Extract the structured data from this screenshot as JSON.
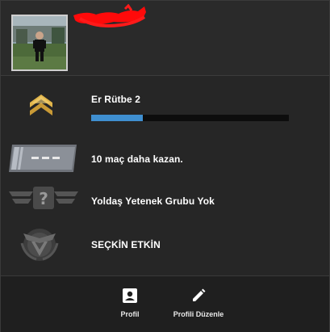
{
  "profile": {
    "avatar_icon": "player-avatar-photo",
    "username_redacted": true
  },
  "rank": {
    "label": "Er Rütbe 2",
    "icon": "chevron-rank-icon",
    "progress": 0.26,
    "progress_color": "#3f8fd0"
  },
  "wins": {
    "label": "10 maç daha kazan.",
    "icon": "competitive-skill-badge-icon"
  },
  "skill_group": {
    "label": "Yoldaş Yetenek Grubu Yok",
    "icon": "unknown-skill-group-icon"
  },
  "commendation": {
    "label": "SEÇKİN ETKİN",
    "icon": "prime-emblem-icon"
  },
  "footer": {
    "profile_label": "Profil",
    "edit_label": "Profili Düzenle",
    "profile_icon": "profile-card-icon",
    "edit_icon": "pencil-icon"
  }
}
